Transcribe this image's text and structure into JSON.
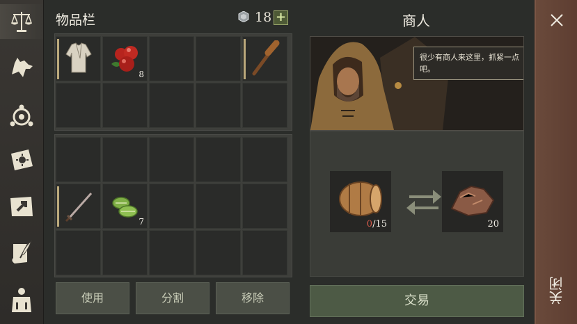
{
  "nav": {
    "items": [
      {
        "icon": "scales-icon",
        "active": true
      },
      {
        "icon": "wolf-icon"
      },
      {
        "icon": "compass-icon"
      },
      {
        "icon": "sun-book-icon"
      },
      {
        "icon": "map-arrow-icon"
      },
      {
        "icon": "scroll-quill-icon"
      },
      {
        "icon": "armor-icon"
      }
    ]
  },
  "inventory": {
    "title": "物品栏",
    "currency": "18",
    "add_label": "+",
    "items": {
      "shirt": {
        "icon": "shirt-icon"
      },
      "apples": {
        "icon": "apples-icon",
        "count": "8"
      },
      "club": {
        "icon": "club-icon"
      },
      "sword": {
        "icon": "sword-icon"
      },
      "leaves": {
        "icon": "cabbage-icon",
        "count": "7"
      }
    },
    "buttons": {
      "use": "使用",
      "split": "分割",
      "remove": "移除"
    }
  },
  "merchant": {
    "title": "商人",
    "speech": "很少有商人来这里，抓紧一点吧。",
    "give": {
      "icon": "barrel-icon",
      "have": "0",
      "need": "/15"
    },
    "receive": {
      "icon": "copper-ore-icon",
      "count": "20"
    },
    "trade_label": "交易"
  },
  "close": {
    "label": "关闭"
  },
  "colors": {
    "accent_green": "#4e5a36",
    "close_bar": "#6a4a3b",
    "warning_red": "#d65a4b"
  }
}
